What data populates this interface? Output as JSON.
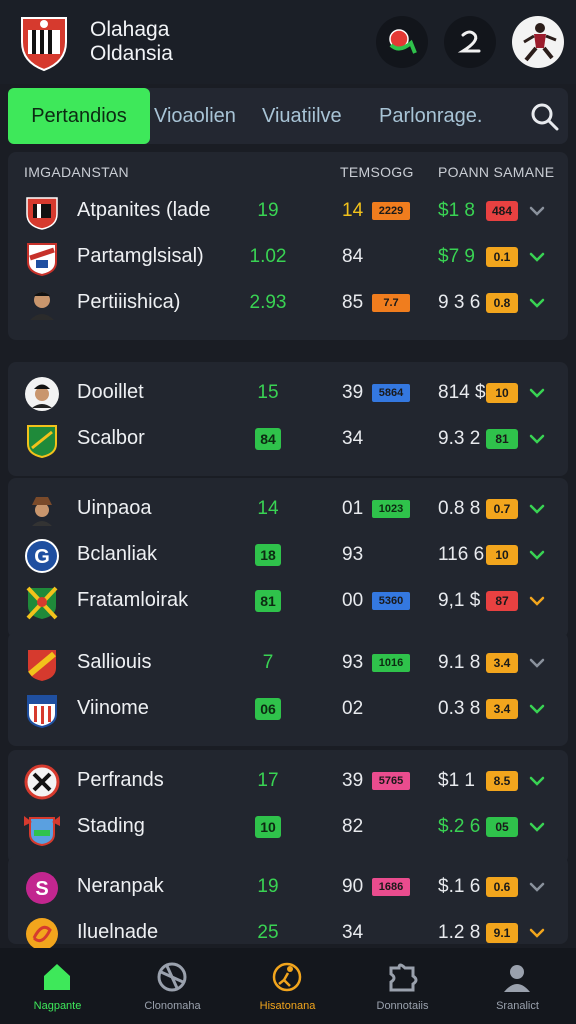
{
  "app": {
    "title_line1": "Olahaga",
    "title_line2": "Oldansia"
  },
  "tabs": [
    {
      "label": "Pertandios",
      "active": true
    },
    {
      "label": "Vioaolien",
      "active": false
    },
    {
      "label": "Viuatiilve",
      "active": false
    },
    {
      "label": "Parlonrage.",
      "active": false
    }
  ],
  "columns": {
    "team": "IMGADANSTAN",
    "stats": "TEMSOGG",
    "odds": "POANN SAMANE"
  },
  "colors": {
    "accent": "#3ee85a",
    "green": "#39d353",
    "orange": "#f07d1e",
    "red": "#e84141",
    "amber": "#f2a51d",
    "blue": "#3478e0",
    "pink": "#ea4c8e"
  },
  "groups": [
    {
      "rows": [
        {
          "icon": "red-black-shield-icon",
          "name": "Atpanites (lade",
          "num1": "19",
          "num1_box": false,
          "num2": "14",
          "num2_color": "#f2c21b",
          "badge": "2229",
          "badge_color": "#f07d1e",
          "val": "$1 8",
          "val_color": "#39d353",
          "badge2": "484",
          "badge2_color": "#e84141",
          "chev": "chevron-grey"
        },
        {
          "icon": "striped-crest-icon",
          "name": "Partamglsisal)",
          "num1": "1.02",
          "num1_box": false,
          "num2": "84",
          "num2_color": "#e8eaee",
          "badge": "",
          "badge_color": "",
          "val": "$7 9",
          "val_color": "#39d353",
          "badge2": "0.1",
          "badge2_color": "#f2a51d",
          "chev": "chevron-green"
        },
        {
          "icon": "player-face-icon",
          "name": "Pertiiishica)",
          "num1": "2.93",
          "num1_box": false,
          "num2": "85",
          "num2_color": "#e8eaee",
          "badge": "7.7",
          "badge_color": "#f07d1e",
          "val": "9 3 6",
          "val_color": "#e8eaee",
          "badge2": "0.8",
          "badge2_color": "#f2a51d",
          "chev": "chevron-green"
        }
      ]
    },
    {
      "rows": [
        {
          "icon": "player-cap-icon",
          "name": "Dooillet",
          "num1": "15",
          "num1_box": false,
          "num2": "39",
          "num2_color": "#e8eaee",
          "badge": "5864",
          "badge_color": "#3478e0",
          "val": "814 $",
          "val_color": "#e8eaee",
          "badge2": "10",
          "badge2_color": "#f2a51d",
          "chev": "chevron-green"
        },
        {
          "icon": "green-shield-icon",
          "name": "Scalbor",
          "num1": "84",
          "num1_box": true,
          "num2": "34",
          "num2_color": "#e8eaee",
          "badge": "",
          "badge_color": "",
          "val": "9.3 2",
          "val_color": "#e8eaee",
          "badge2": "81",
          "badge2_color": "#2fc24b",
          "chev": "chevron-green"
        }
      ]
    },
    {
      "rows": [
        {
          "icon": "player-hat-icon",
          "name": "Uinpaoa",
          "num1": "14",
          "num1_box": false,
          "num2": "01",
          "num2_color": "#e8eaee",
          "badge": "1023",
          "badge_color": "#2fc24b",
          "val": "0.8 8",
          "val_color": "#e8eaee",
          "badge2": "0.7",
          "badge2_color": "#f2a51d",
          "chev": "chevron-green"
        },
        {
          "icon": "g-badge-icon",
          "name": "Bclanliak",
          "num1": "18",
          "num1_box": true,
          "num2": "93",
          "num2_color": "#e8eaee",
          "badge": "",
          "badge_color": "",
          "val": "116 6",
          "val_color": "#e8eaee",
          "badge2": "10",
          "badge2_color": "#f2a51d",
          "chev": "chevron-green"
        },
        {
          "icon": "cross-shield-icon",
          "name": "Fratamloirak",
          "num1": "81",
          "num1_box": true,
          "num2": "00",
          "num2_color": "#e8eaee",
          "badge": "5360",
          "badge_color": "#3478e0",
          "val": "9,1 $",
          "val_color": "#e8eaee",
          "badge2": "87",
          "badge2_color": "#e84141",
          "chev": "chevron-amber"
        }
      ]
    },
    {
      "rows": [
        {
          "icon": "red-yellow-crest-icon",
          "name": "Salliouis",
          "num1": "7",
          "num1_box": false,
          "num2": "93",
          "num2_color": "#e8eaee",
          "badge": "1016",
          "badge_color": "#2fc24b",
          "val": "9.1 8",
          "val_color": "#e8eaee",
          "badge2": "3.4",
          "badge2_color": "#f2a51d",
          "chev": "chevron-grey"
        },
        {
          "icon": "blue-stripe-shield-icon",
          "name": "Viinome",
          "num1": "06",
          "num1_box": true,
          "num2": "02",
          "num2_color": "#e8eaee",
          "badge": "",
          "badge_color": "",
          "val": "0.3 8",
          "val_color": "#e8eaee",
          "badge2": "3.4",
          "badge2_color": "#f2a51d",
          "chev": "chevron-green"
        }
      ]
    },
    {
      "rows": [
        {
          "icon": "round-emblem-icon",
          "name": "Perfrands",
          "num1": "17",
          "num1_box": false,
          "num2": "39",
          "num2_color": "#e8eaee",
          "badge": "5765",
          "badge_color": "#ea4c8e",
          "val": "$1 1",
          "val_color": "#e8eaee",
          "badge2": "8.5",
          "badge2_color": "#f2a51d",
          "chev": "chevron-green"
        },
        {
          "icon": "winged-crest-icon",
          "name": "Stading",
          "num1": "10",
          "num1_box": true,
          "num2": "82",
          "num2_color": "#e8eaee",
          "badge": "",
          "badge_color": "",
          "val": "$.2 6",
          "val_color": "#39d353",
          "badge2": "05",
          "badge2_color": "#2fc24b",
          "chev": "chevron-green"
        }
      ]
    },
    {
      "rows": [
        {
          "icon": "pink-s-logo-icon",
          "name": "Neranpak",
          "num1": "19",
          "num1_box": false,
          "num2": "90",
          "num2_color": "#e8eaee",
          "badge": "1686",
          "badge_color": "#ea4c8e",
          "val": "$.1 6",
          "val_color": "#e8eaee",
          "badge2": "0.6",
          "badge2_color": "#f2a51d",
          "chev": "chevron-grey"
        },
        {
          "icon": "orange-swirl-icon",
          "name": "Iluelnade",
          "num1": "25",
          "num1_box": false,
          "num2": "34",
          "num2_color": "#e8eaee",
          "badge": "",
          "badge_color": "",
          "val": "1.2 8",
          "val_color": "#e8eaee",
          "badge2": "9.1",
          "badge2_color": "#f2a51d",
          "chev": "chevron-amber"
        }
      ]
    }
  ],
  "nav": [
    {
      "label": "Nagpante",
      "icon": "home-icon",
      "active": true
    },
    {
      "label": "Clonomaha",
      "icon": "globe-ball-icon",
      "active": false
    },
    {
      "label": "Hisatonana",
      "icon": "soccer-player-icon",
      "active": false
    },
    {
      "label": "Donnotaiis",
      "icon": "puzzle-icon",
      "active": false
    },
    {
      "label": "Sranalict",
      "icon": "profile-icon",
      "active": false
    }
  ]
}
